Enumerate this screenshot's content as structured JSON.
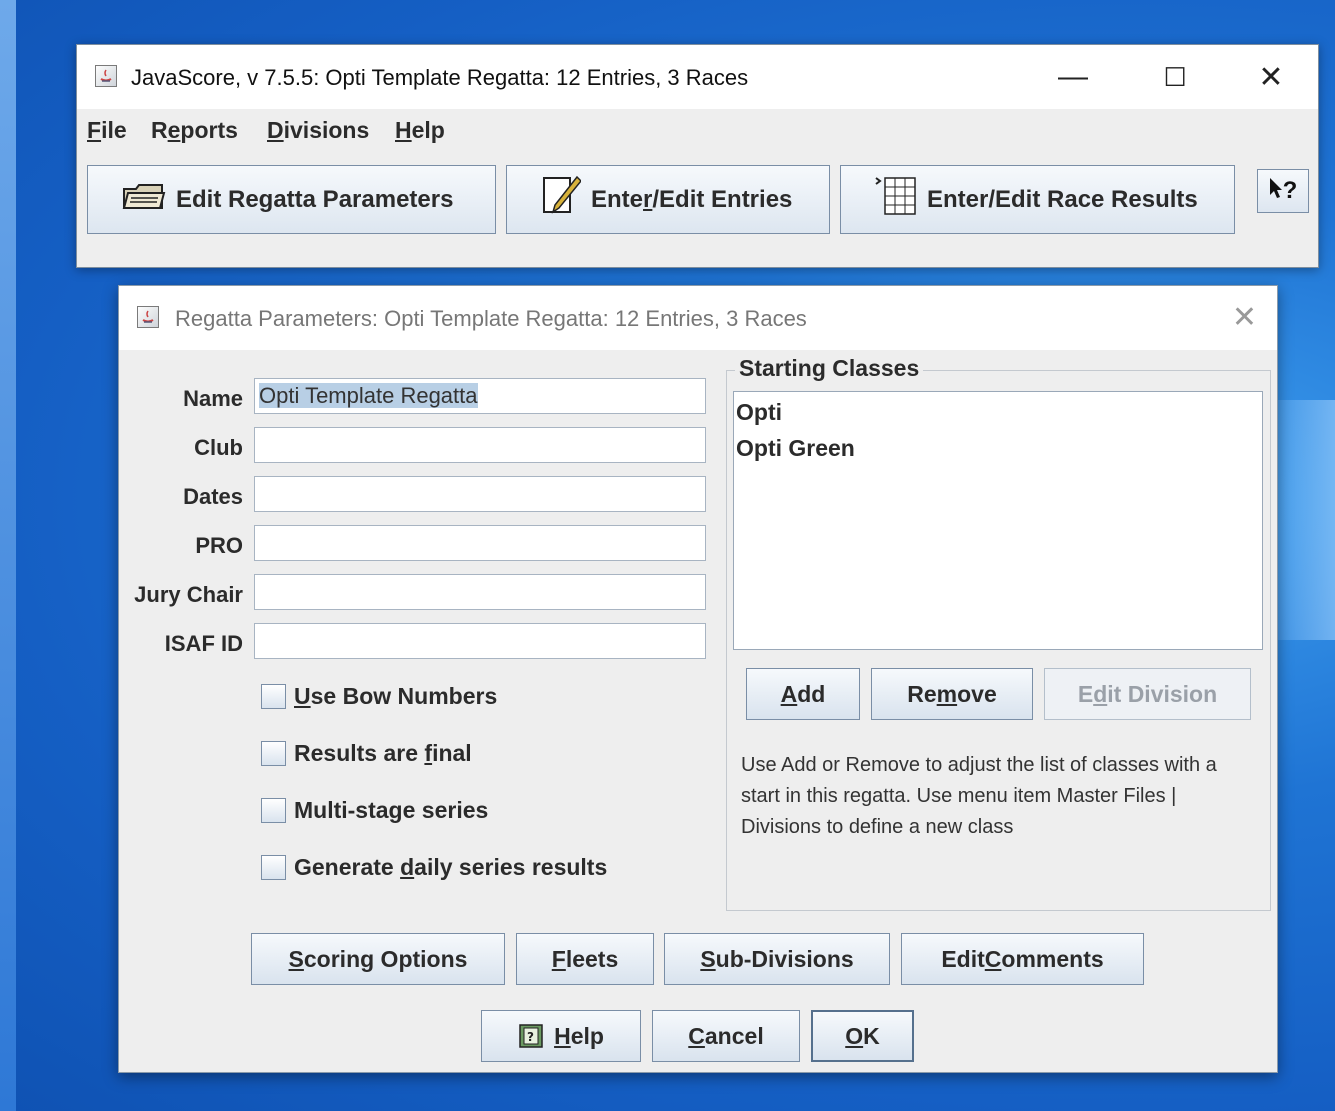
{
  "main_window": {
    "title": "JavaScore, v 7.5.5: Opti Template Regatta: 12 Entries, 3 Races",
    "menu": [
      {
        "pre": "",
        "u": "F",
        "post": "ile"
      },
      {
        "pre": "R",
        "u": "e",
        "post": "ports"
      },
      {
        "pre": "",
        "u": "D",
        "post": "ivisions"
      },
      {
        "pre": "",
        "u": "H",
        "post": "elp"
      }
    ],
    "toolbar": {
      "edit_regatta": "Edit Regatta Parameters",
      "entries": {
        "pre": "Ente",
        "u": "r",
        "post": "/Edit Entries"
      },
      "race_results": "Enter/Edit Race Results",
      "help_cursor": "?"
    },
    "caption": {
      "minimize": "—",
      "maximize": "☐",
      "close": "✕"
    }
  },
  "dialog": {
    "title": "Regatta Parameters: Opti Template Regatta: 12 Entries, 3 Races",
    "close": "✕",
    "fields": {
      "name": {
        "label": "Name",
        "value": "Opti Template Regatta"
      },
      "club": {
        "label": "Club",
        "value": ""
      },
      "dates": {
        "label": "Dates",
        "value": ""
      },
      "pro": {
        "label": "PRO",
        "value": ""
      },
      "jury_chair": {
        "label": "Jury Chair",
        "value": ""
      },
      "isaf_id": {
        "label": "ISAF ID",
        "value": ""
      }
    },
    "checkboxes": [
      {
        "pre": "",
        "u": "U",
        "post": "se Bow Numbers",
        "checked": false
      },
      {
        "pre": "Results are ",
        "u": "f",
        "post": "inal",
        "checked": false
      },
      {
        "pre": "Multi-stage series",
        "u": "",
        "post": "",
        "checked": false
      },
      {
        "pre": "Generate ",
        "u": "d",
        "post": "aily series results",
        "checked": false
      }
    ],
    "starting_classes": {
      "legend": "Starting Classes",
      "items": [
        "Opti",
        "Opti Green"
      ],
      "add": {
        "pre": "",
        "u": "A",
        "post": "dd"
      },
      "remove": {
        "pre": "Re",
        "u": "m",
        "post": "ove"
      },
      "edit_division": {
        "pre": "E",
        "u": "d",
        "post": "it Division"
      },
      "help_text": "Use Add or Remove to adjust the list of classes with a start in this regatta. Use menu item Master Files | Divisions to define a new class"
    },
    "buttons": {
      "scoring_options": {
        "pre": "",
        "u": "S",
        "post": "coring Options"
      },
      "fleets": {
        "pre": "",
        "u": "F",
        "post": "leets"
      },
      "sub_divisions": {
        "pre": "",
        "u": "S",
        "post": "ub-Divisions"
      },
      "edit_comments": {
        "pre": "Edit ",
        "u": "C",
        "post": "omments"
      },
      "help": {
        "pre": "",
        "u": "H",
        "post": "elp"
      },
      "cancel": {
        "pre": "",
        "u": "C",
        "post": "ancel"
      },
      "ok": {
        "pre": "",
        "u": "O",
        "post": "K"
      }
    }
  },
  "colors": {
    "desktop": "#1f74d4",
    "window_bg": "#eeeeee",
    "button_border": "#7a8ea6",
    "selection": "#b8cfe5"
  }
}
